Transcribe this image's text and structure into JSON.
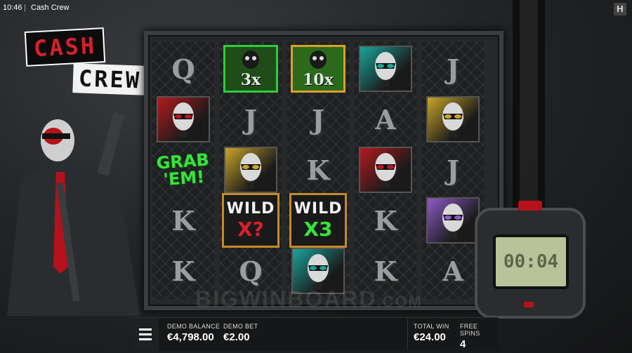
{
  "topbar": {
    "time": "10:46",
    "separator": "|",
    "title": "Cash Crew",
    "brand_icon": "H"
  },
  "logo": {
    "line1": "CASH",
    "line2": "CREW"
  },
  "reels": [
    [
      {
        "type": "letter",
        "text": "Q"
      },
      {
        "type": "mask",
        "color": "#b31a1f"
      },
      {
        "type": "grab",
        "text": "GRAB 'EM!"
      },
      {
        "type": "letter",
        "text": "K"
      },
      {
        "type": "letter",
        "text": "K"
      }
    ],
    [
      {
        "type": "mult",
        "text": "3x",
        "style": "green"
      },
      {
        "type": "letter",
        "text": "J"
      },
      {
        "type": "mask",
        "color": "#c9a52a"
      },
      {
        "type": "wild",
        "label": "WILD",
        "mult": "X?",
        "mult_color": "#d8202a"
      },
      {
        "type": "letter",
        "text": "Q"
      }
    ],
    [
      {
        "type": "mult",
        "text": "10x",
        "style": "gold"
      },
      {
        "type": "letter",
        "text": "J"
      },
      {
        "type": "letter",
        "text": "K"
      },
      {
        "type": "wild",
        "label": "WILD",
        "mult": "X3",
        "mult_color": "#36e43b"
      },
      {
        "type": "mask",
        "color": "#1aa59b"
      }
    ],
    [
      {
        "type": "mask",
        "color": "#1aa59b"
      },
      {
        "type": "letter",
        "text": "A"
      },
      {
        "type": "mask",
        "color": "#b31a1f"
      },
      {
        "type": "letter",
        "text": "K"
      },
      {
        "type": "letter",
        "text": "K"
      }
    ],
    [
      {
        "type": "letter",
        "text": "J"
      },
      {
        "type": "mask",
        "color": "#c9a52a"
      },
      {
        "type": "letter",
        "text": "J"
      },
      {
        "type": "mask",
        "color": "#8e5bc7"
      },
      {
        "type": "letter",
        "text": "A"
      }
    ]
  ],
  "watermark": {
    "main": "BIGWINBOARD",
    "suffix": ".COM"
  },
  "timer": {
    "display": "00:04"
  },
  "bottombar": {
    "balance_label": "DEMO BALANCE",
    "balance_value": "€4,798.00",
    "bet_label": "DEMO BET",
    "bet_value": "€2.00",
    "win_label": "TOTAL WIN",
    "win_value": "€24.00",
    "spins_label": "FREE SPINS",
    "spins_value": "4"
  },
  "colors": {
    "accent_red": "#d8202a",
    "wild_green": "#36e43b",
    "gold": "#d9a12a"
  }
}
